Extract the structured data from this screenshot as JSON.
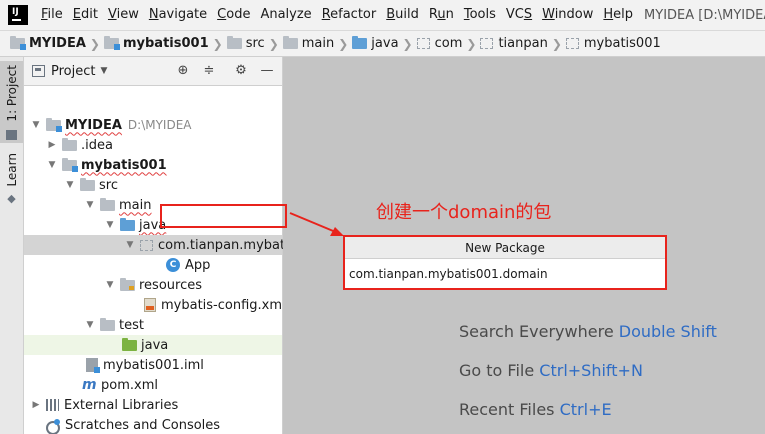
{
  "menu": {
    "items": [
      {
        "label": "File",
        "underline": "F"
      },
      {
        "label": "Edit",
        "underline": "E"
      },
      {
        "label": "View",
        "underline": "V"
      },
      {
        "label": "Navigate",
        "underline": "N"
      },
      {
        "label": "Code",
        "underline": "C"
      },
      {
        "label": "Analyze",
        "underline": ""
      },
      {
        "label": "Refactor",
        "underline": "R"
      },
      {
        "label": "Build",
        "underline": "B"
      },
      {
        "label": "Run",
        "underline": "u"
      },
      {
        "label": "Tools",
        "underline": "T"
      },
      {
        "label": "VCS",
        "underline": "S"
      },
      {
        "label": "Window",
        "underline": "W"
      },
      {
        "label": "Help",
        "underline": "H"
      }
    ],
    "window_title": "MYIDEA [D:\\MYIDEA] - In"
  },
  "breadcrumb": [
    "MYIDEA",
    "mybatis001",
    "src",
    "main",
    "java",
    "com",
    "tianpan",
    "mybatis001"
  ],
  "left_stripe": {
    "project_tab": "1: Project",
    "learn_tab": "Learn"
  },
  "panel": {
    "title": "Project"
  },
  "tree": {
    "root": {
      "label": "MYIDEA",
      "path": "D:\\MYIDEA"
    },
    "idea": ".idea",
    "module": "mybatis001",
    "src": "src",
    "main": "main",
    "java": "java",
    "package": "com.tianpan.mybatis",
    "app": "App",
    "resources": "resources",
    "config": "mybatis-config.xml",
    "test": "test",
    "test_java": "java",
    "iml": "mybatis001.iml",
    "pom": "pom.xml",
    "external": "External Libraries",
    "scratches": "Scratches and Consoles"
  },
  "editor_hints": [
    {
      "text": "Search Everywhere",
      "key": "Double Shift"
    },
    {
      "text": "Go to File",
      "key": "Ctrl+Shift+N"
    },
    {
      "text": "Recent Files",
      "key": "Ctrl+E"
    }
  ],
  "annotation": {
    "text": "创建一个domain的包",
    "color": "#e8231c"
  },
  "dialog": {
    "title": "New Package",
    "value": "com.tianpan.mybatis001.domain"
  },
  "icons": {
    "app_logo": "intellij-logo-icon",
    "locate": "crosshair-icon",
    "collapse": "collapse-all-icon",
    "settings": "gear-icon",
    "hide": "minimize-icon"
  }
}
